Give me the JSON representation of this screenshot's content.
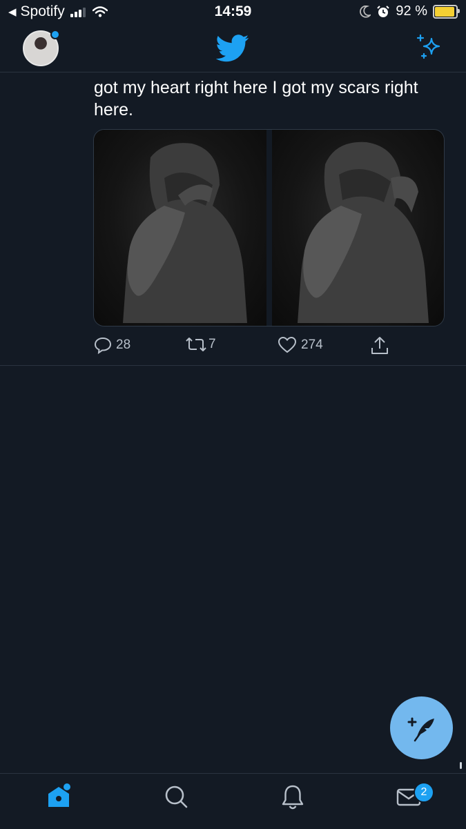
{
  "status_bar": {
    "back_app": "Spotify",
    "time": "14:59",
    "battery_percent": "92 %",
    "battery_level": 0.92,
    "icons": [
      "back-arrow-icon",
      "signal-icon",
      "wifi-icon",
      "moon-icon",
      "alarm-icon",
      "battery-icon"
    ]
  },
  "header": {
    "logo_icon": "twitter-bird-icon",
    "sparkle_icon": "sparkle-icon",
    "accent": "#1da1f2"
  },
  "tweet": {
    "text": "got my heart right here I got my scars right here.",
    "images": [
      "photo-1",
      "photo-2"
    ],
    "replies": "28",
    "retweets": "7",
    "likes": "274"
  },
  "fab": {
    "icon": "compose-feather-icon",
    "color": "#73b8ee"
  },
  "tabbar": {
    "tabs": [
      "home-icon",
      "search-icon",
      "notifications-bell-icon",
      "messages-envelope-icon"
    ],
    "messages_badge": "2"
  }
}
